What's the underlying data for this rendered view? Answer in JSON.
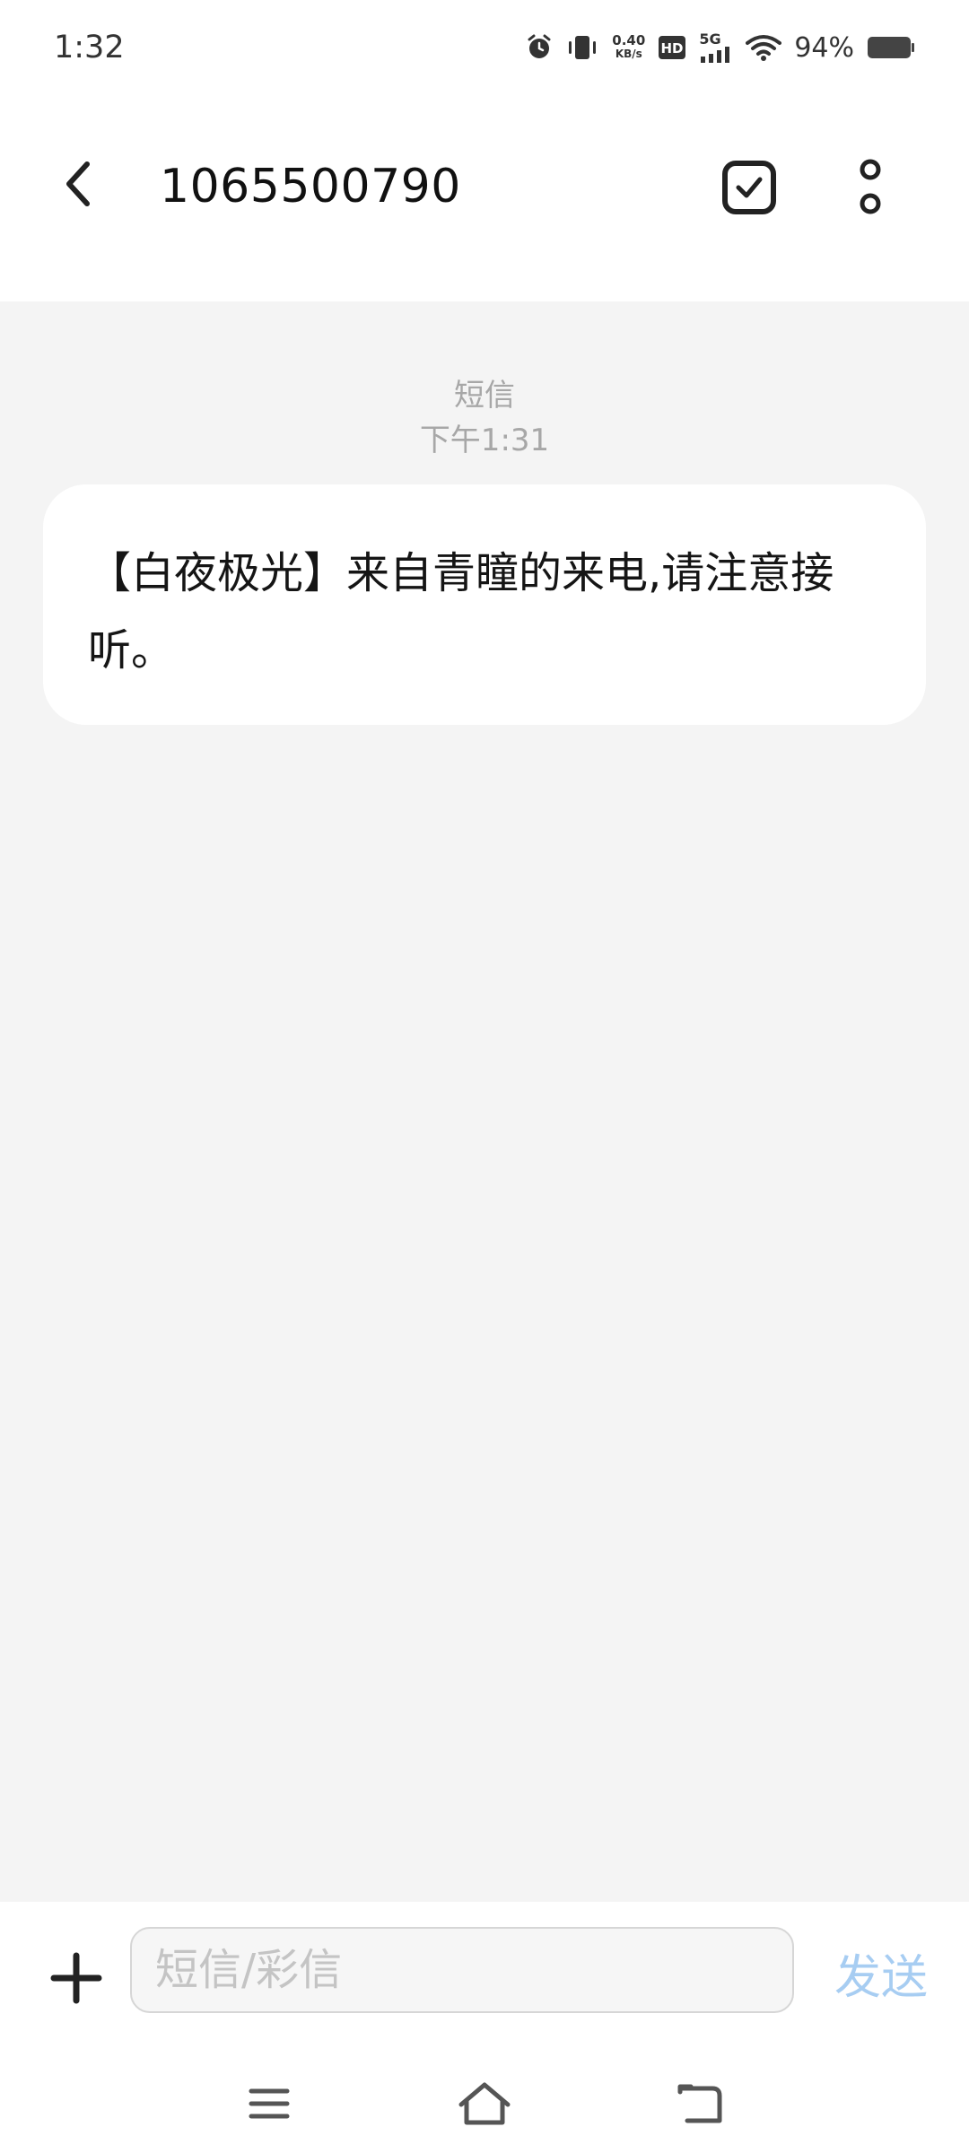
{
  "status_bar": {
    "time": "1:32",
    "net_speed_value": "0.40",
    "net_speed_unit": "KB/s",
    "network_type": "5G",
    "battery_percent": "94%",
    "icons": [
      "alarm-icon",
      "vibrate-icon",
      "hd-icon",
      "signal-icon",
      "wifi-icon",
      "battery-icon"
    ]
  },
  "app_bar": {
    "title": "1065500790",
    "icons": [
      "back-arrow-icon",
      "checkbox-icon",
      "more-vertical-icon"
    ]
  },
  "conversation": {
    "channel": "短信",
    "timestamp": "下午1:31",
    "messages": [
      {
        "text": "【白夜极光】来自青瞳的来电,请注意接听。"
      }
    ]
  },
  "composer": {
    "placeholder": "短信/彩信",
    "value": "",
    "send_label": "发送",
    "send_color": "#a7cdf2"
  },
  "nav_bar": {
    "icons": [
      "menu-icon",
      "home-icon",
      "back-icon"
    ]
  }
}
